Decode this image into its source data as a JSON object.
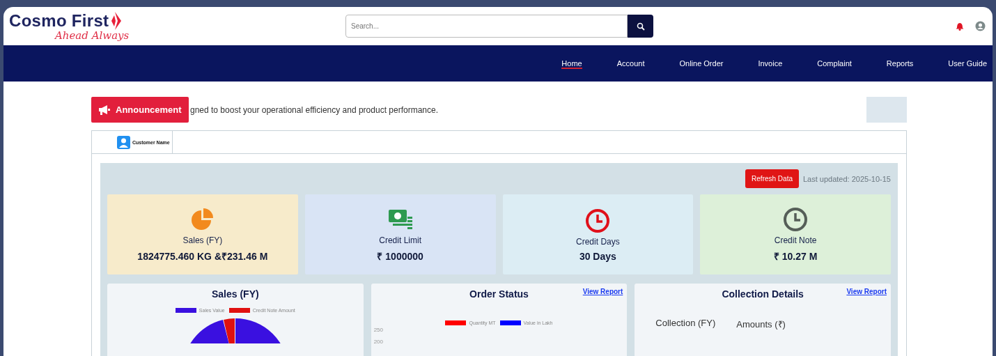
{
  "header": {
    "brand": "Cosmo First",
    "tagline": "Ahead Always",
    "search": {
      "placeholder": "Search..."
    }
  },
  "nav": [
    {
      "label": "Home",
      "selected": true
    },
    {
      "label": "Account",
      "selected": false
    },
    {
      "label": "Online Order",
      "selected": false
    },
    {
      "label": "Invoice",
      "selected": false
    },
    {
      "label": "Complaint",
      "selected": false
    },
    {
      "label": "Reports",
      "selected": false
    },
    {
      "label": "User Guide",
      "selected": false
    }
  ],
  "announcement": {
    "label": "Announcement",
    "text": "gned to boost your operational efficiency and product performance."
  },
  "customer_tab": {
    "label": "Customer Name"
  },
  "refresh": {
    "button": "Refresh Data",
    "last_updated": "Last updated: 2025-10-15"
  },
  "stats": [
    {
      "kind": "sales",
      "label": "Sales (FY)",
      "value": "1824775.460 KG &₹231.46 M"
    },
    {
      "kind": "credit-limit",
      "label": "Credit Limit",
      "value": "₹ 1000000"
    },
    {
      "kind": "credit-days",
      "label": "Credit Days",
      "value": "30 Days"
    },
    {
      "kind": "credit-note",
      "label": "Credit Note",
      "value": "₹ 10.27 M"
    }
  ],
  "panels": [
    {
      "kind": "donut",
      "title": "Sales (FY)",
      "legend": [
        {
          "label": "Sales Value",
          "color": "#3a10e0"
        },
        {
          "label": "Credit Note Amount",
          "color": "#e01010"
        }
      ]
    },
    {
      "kind": "bar",
      "title": "Order Status",
      "link": "View Report",
      "legend": [
        {
          "label": "Quantity MT",
          "color": "#ff0000"
        },
        {
          "label": "Value in Lakh",
          "color": "#0000ff"
        }
      ],
      "ticks": [
        "250",
        "200"
      ]
    },
    {
      "kind": "table",
      "title": "Collection Details",
      "link": "View Report",
      "columns": [
        "Collection (FY)",
        "Amounts (₹)"
      ]
    }
  ]
}
